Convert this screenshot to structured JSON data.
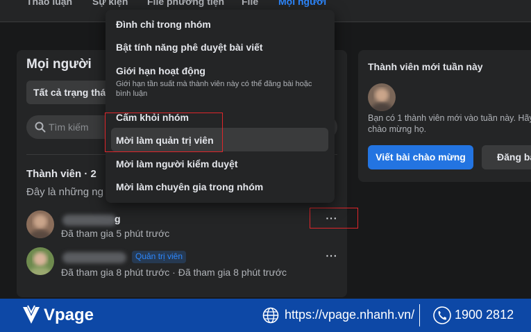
{
  "nav": {
    "tabs": [
      {
        "label": "Thảo luận"
      },
      {
        "label": "Sự kiện"
      },
      {
        "label": "File phương tiện"
      },
      {
        "label": "File"
      },
      {
        "label": "Mọi người"
      }
    ],
    "active_tab": "Mọi người"
  },
  "people": {
    "title": "Mọi người",
    "status_filter": "Tất cả trạng thá",
    "search_placeholder": "Tìm kiếm",
    "members_heading": "Thành viên · 2",
    "members_desc": "Đây là những ng",
    "members": [
      {
        "name_suffix": "g",
        "joined": "Đã tham gia 5 phút trước",
        "badge": ""
      },
      {
        "name_suffix": "",
        "joined": "Đã tham gia 8 phút trước · Đã tham gia 8 phút trước",
        "badge": "Quản trị viên"
      }
    ],
    "more_label": "···"
  },
  "menu": {
    "items": [
      {
        "label": "Đình chỉ trong nhóm"
      },
      {
        "label": "Bật tính năng phê duyệt bài viết"
      },
      {
        "label": "Giới hạn hoạt động",
        "sub": "Giới hạn tần suất mà thành viên này có thể đăng bài hoặc bình luận"
      },
      {
        "label": "Cấm khỏi nhóm"
      },
      {
        "label": "Mời làm quản trị viên"
      },
      {
        "label": "Mời làm người kiểm duyệt"
      },
      {
        "label": "Mời làm chuyên gia trong nhóm"
      }
    ],
    "highlighted": "Mời làm quản trị viên"
  },
  "new_members": {
    "title": "Thành viên mới tuần này",
    "text": "Bạn có 1 thành viên mới vào tuần này. Hãy chào mừng họ.",
    "welcome_button": "Viết bài chào mừng",
    "post_button": "Đăng bài"
  },
  "footer": {
    "brand": "Vpage",
    "url": "https://vpage.nhanh.vn/",
    "phone": "1900 2812"
  },
  "colors": {
    "background": "#18191a",
    "card": "#242526",
    "accent": "#2d88ff",
    "button": "#2374e1",
    "highlight_box": "#e0262b",
    "footer": "#0d48a6"
  }
}
